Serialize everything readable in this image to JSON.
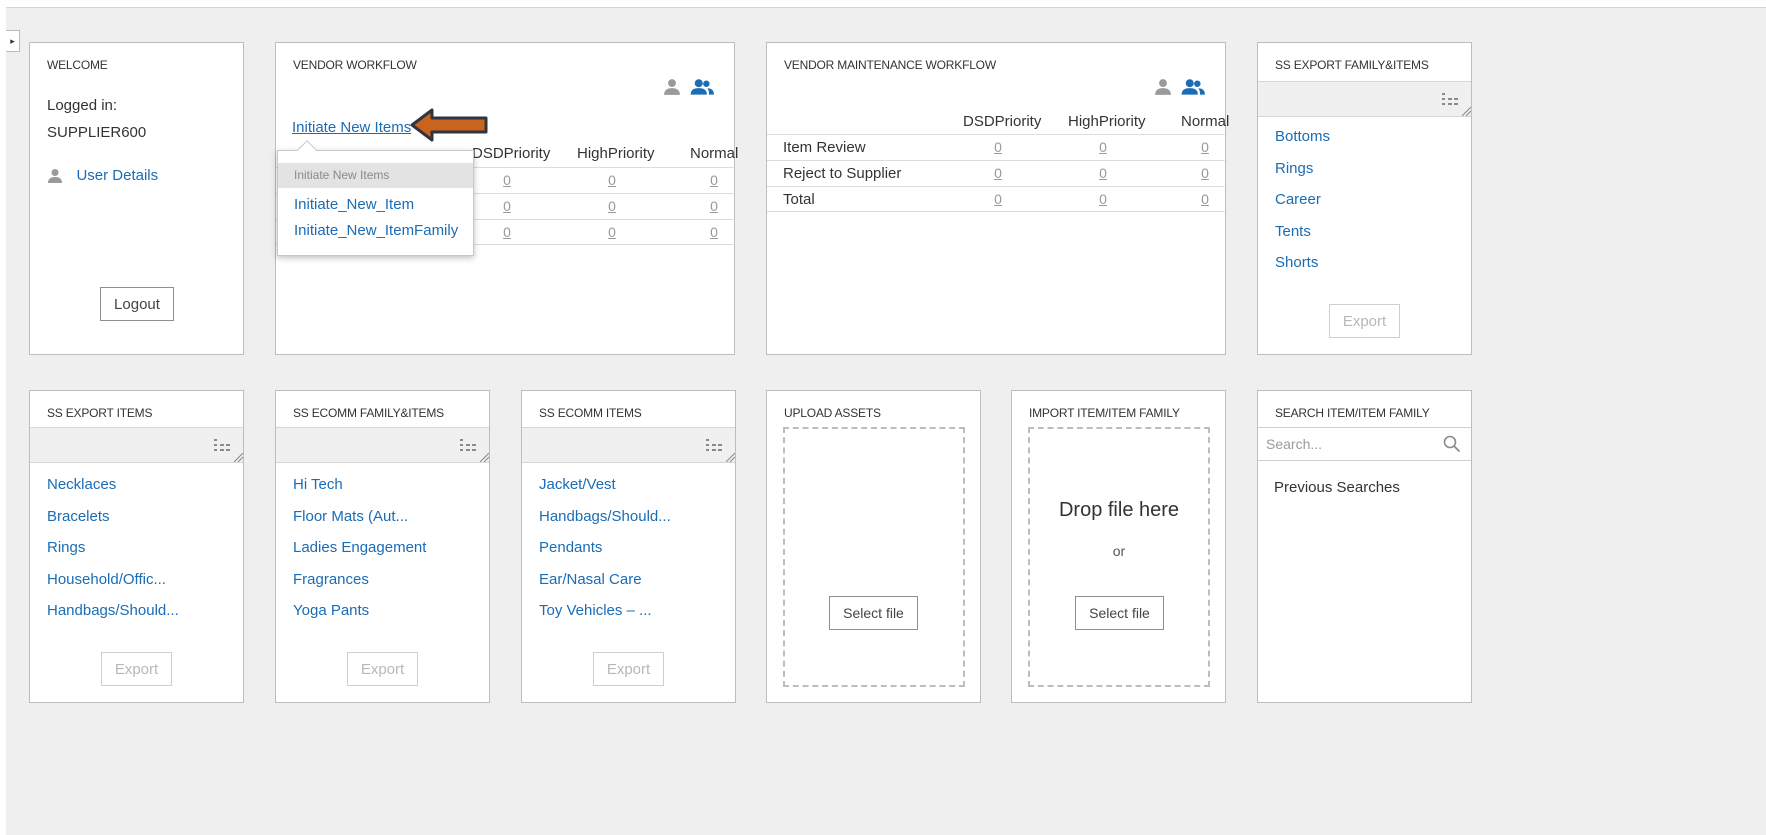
{
  "welcome": {
    "title": "WELCOME",
    "logged_in_label": "Logged in:",
    "username": "SUPPLIER600",
    "user_details": "User Details",
    "logout": "Logout"
  },
  "vendor_workflow": {
    "title": "VENDOR WORKFLOW",
    "initiate_link": "Initiate New Items",
    "columns": [
      "DSDPriority",
      "HighPriority",
      "Normal"
    ],
    "rows": [
      {
        "values": [
          "0",
          "0",
          "0"
        ]
      },
      {
        "values": [
          "0",
          "0",
          "0"
        ]
      },
      {
        "values": [
          "0",
          "0",
          "0"
        ]
      }
    ],
    "popup": {
      "header": "Initiate New Items",
      "items": [
        "Initiate_New_Item",
        "Initiate_New_ItemFamily"
      ]
    },
    "arrow_color": "#c8641e"
  },
  "vendor_maintenance": {
    "title": "VENDOR MAINTENANCE WORKFLOW",
    "columns": [
      "DSDPriority",
      "HighPriority",
      "Normal"
    ],
    "rows": [
      {
        "label": "Item Review",
        "values": [
          "0",
          "0",
          "0"
        ]
      },
      {
        "label": "Reject to Supplier",
        "values": [
          "0",
          "0",
          "0"
        ]
      },
      {
        "label": "Total",
        "values": [
          "0",
          "0",
          "0"
        ]
      }
    ]
  },
  "ss_export_family": {
    "title": "SS EXPORT FAMILY&ITEMS",
    "items": [
      "Bottoms",
      "Rings",
      "Career",
      "Tents",
      "Shorts"
    ],
    "export": "Export"
  },
  "ss_export_items": {
    "title": "SS EXPORT ITEMS",
    "items": [
      "Necklaces",
      "Bracelets",
      "Rings",
      "Household/Offic...",
      "Handbags/Should..."
    ],
    "export": "Export"
  },
  "ss_ecomm_family": {
    "title": "SS ECOMM FAMILY&ITEMS",
    "items": [
      "Hi Tech",
      "Floor Mats (Aut...",
      "Ladies Engagement",
      "Fragrances",
      "Yoga Pants"
    ],
    "export": "Export"
  },
  "ss_ecomm_items": {
    "title": "SS ECOMM ITEMS",
    "items": [
      "Jacket/Vest",
      "Handbags/Should...",
      "Pendants",
      "Ear/Nasal Care",
      "Toy Vehicles – ..."
    ],
    "export": "Export"
  },
  "upload_assets": {
    "title": "UPLOAD ASSETS",
    "select_file": "Select file"
  },
  "import_item": {
    "title": "IMPORT ITEM/ITEM FAMILY",
    "drop_text": "Drop file here",
    "or_text": "or",
    "select_file": "Select file"
  },
  "search_item": {
    "title": "SEARCH ITEM/ITEM FAMILY",
    "placeholder": "Search...",
    "previous": "Previous Searches"
  },
  "colors": {
    "link": "#1a6cb5",
    "background": "#efefef",
    "arrow": "#c8641e"
  }
}
